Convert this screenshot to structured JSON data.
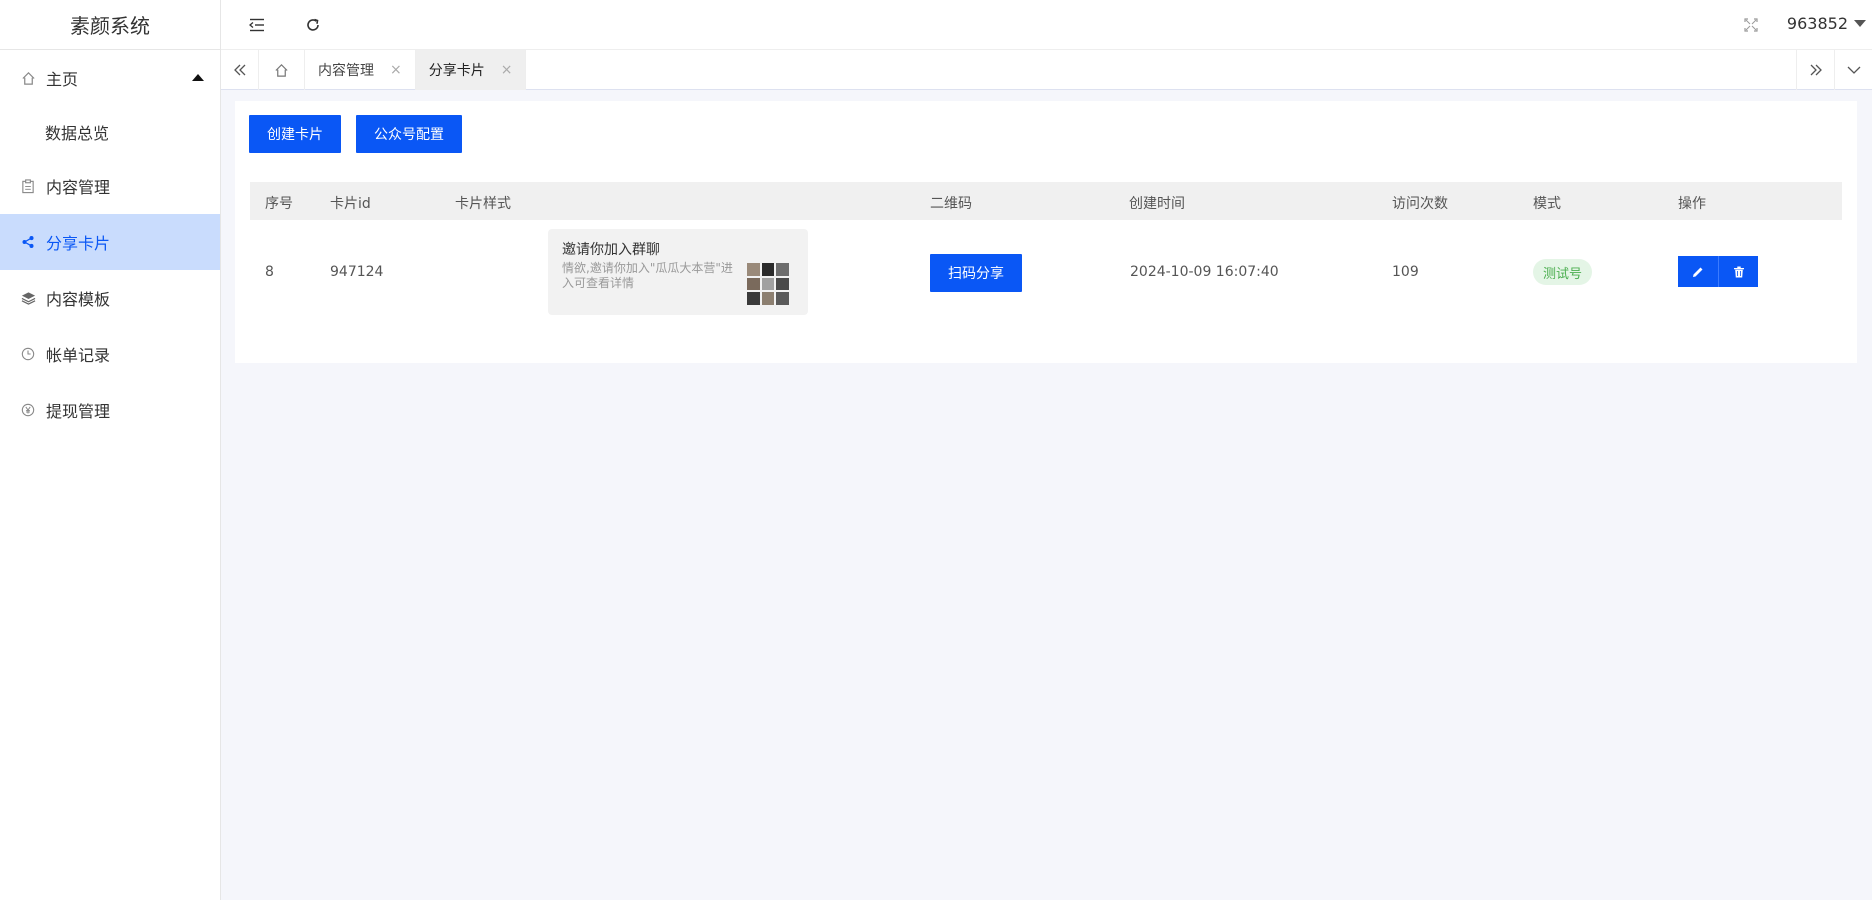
{
  "app": {
    "title": "素颜系统"
  },
  "sidebar": {
    "items": [
      {
        "label": "主页",
        "icon": "home-icon"
      },
      {
        "label": "数据总览"
      },
      {
        "label": "内容管理",
        "icon": "clipboard-icon"
      },
      {
        "label": "分享卡片",
        "icon": "share-icon"
      },
      {
        "label": "内容模板",
        "icon": "layers-icon"
      },
      {
        "label": "帐单记录",
        "icon": "clock-icon"
      },
      {
        "label": "提现管理",
        "icon": "yen-icon"
      }
    ]
  },
  "header": {
    "user": "963852"
  },
  "tabs": [
    {
      "label": "内容管理"
    },
    {
      "label": "分享卡片"
    }
  ],
  "toolbar": {
    "create_label": "创建卡片",
    "config_label": "公众号配置"
  },
  "table": {
    "headers": [
      "序号",
      "卡片id",
      "卡片样式",
      "二维码",
      "创建时间",
      "访问次数",
      "模式",
      "操作"
    ],
    "rows": [
      {
        "index": "8",
        "card_id": "947124",
        "card_title": "邀请你加入群聊",
        "card_desc": "情欲,邀请你加入\"瓜瓜大本营\"进入可查看详情",
        "qr_label": "扫码分享",
        "created": "2024-10-09 16:07:40",
        "visits": "109",
        "mode": "测试号"
      }
    ]
  },
  "colors": {
    "primary": "#0a57f5",
    "active_bg": "#c9dcfd",
    "badge_bg": "#e4f5e6",
    "badge_text": "#4caf50"
  }
}
